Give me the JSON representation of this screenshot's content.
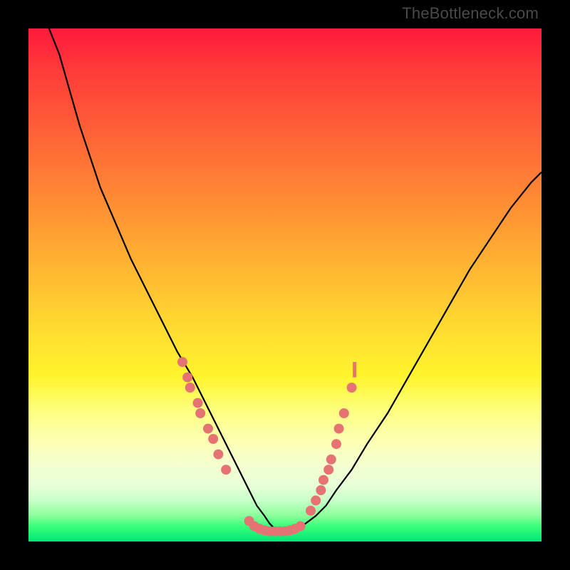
{
  "watermark": "TheBottleneck.com",
  "colors": {
    "background": "#000000",
    "gradient_top": "#ff1a3c",
    "gradient_bottom": "#00e676",
    "curve": "#000000",
    "dots": "#e57373"
  },
  "chart_data": {
    "type": "line",
    "title": "",
    "xlabel": "",
    "ylabel": "",
    "xlim": [
      0,
      100
    ],
    "ylim": [
      0,
      100
    ],
    "grid": false,
    "legend": false,
    "series": [
      {
        "name": "bottleneck-curve",
        "x": [
          4,
          6,
          8,
          10,
          12,
          14,
          17,
          20,
          23,
          26,
          29,
          32,
          34,
          36,
          38,
          40,
          41.5,
          43,
          44.5,
          46,
          47,
          48,
          50,
          52,
          54,
          56,
          58,
          60,
          63,
          66,
          70,
          74,
          78,
          82,
          86,
          90,
          94,
          98,
          100
        ],
        "values": [
          100,
          95,
          88,
          81,
          75,
          69,
          62,
          55,
          49,
          43,
          37,
          32,
          28,
          24,
          20,
          16,
          13,
          10,
          7,
          5,
          3.5,
          2.5,
          2,
          2.5,
          3.5,
          5,
          7,
          10,
          14,
          19,
          25,
          32,
          39,
          46,
          53,
          59,
          65,
          70,
          72
        ]
      }
    ],
    "points": [
      {
        "name": "left-cluster",
        "data": [
          {
            "x": 30,
            "y": 35
          },
          {
            "x": 31,
            "y": 32
          },
          {
            "x": 31.5,
            "y": 30
          },
          {
            "x": 33,
            "y": 27
          },
          {
            "x": 33.5,
            "y": 25
          },
          {
            "x": 35,
            "y": 22
          },
          {
            "x": 36,
            "y": 20
          },
          {
            "x": 37,
            "y": 17
          },
          {
            "x": 38.5,
            "y": 14
          }
        ]
      },
      {
        "name": "bottom-cluster",
        "data": [
          {
            "x": 43,
            "y": 4
          },
          {
            "x": 44,
            "y": 3
          },
          {
            "x": 45,
            "y": 2.5
          },
          {
            "x": 46,
            "y": 2.2
          },
          {
            "x": 47,
            "y": 2
          },
          {
            "x": 48,
            "y": 2
          },
          {
            "x": 49,
            "y": 2
          },
          {
            "x": 50,
            "y": 2
          },
          {
            "x": 51,
            "y": 2.2
          },
          {
            "x": 52,
            "y": 2.5
          },
          {
            "x": 53,
            "y": 3
          }
        ]
      },
      {
        "name": "right-cluster",
        "data": [
          {
            "x": 55,
            "y": 6
          },
          {
            "x": 56,
            "y": 8
          },
          {
            "x": 57,
            "y": 10
          },
          {
            "x": 57.5,
            "y": 12
          },
          {
            "x": 58.5,
            "y": 14
          },
          {
            "x": 59,
            "y": 16
          },
          {
            "x": 60,
            "y": 19
          },
          {
            "x": 60.5,
            "y": 22
          },
          {
            "x": 61.5,
            "y": 25
          },
          {
            "x": 63,
            "y": 30
          }
        ]
      }
    ],
    "annotations": [
      {
        "name": "right-tick-mark",
        "x": 63.5,
        "y": 32,
        "height": 3
      }
    ]
  }
}
